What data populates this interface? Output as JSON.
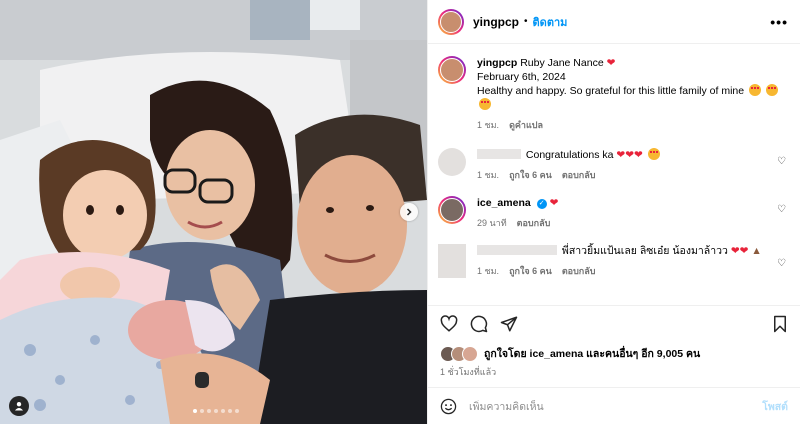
{
  "header": {
    "username": "yingpcp",
    "separator": "•",
    "follow_label": "ติดตาม",
    "more_label": "•••"
  },
  "caption": {
    "username": "yingpcp",
    "line1": "Ruby Jane Nance",
    "line2": "February 6th, 2024",
    "line3": "Healthy and happy. So grateful for this little family of mine",
    "time": "1 ชม.",
    "translate_label": "ดูคำแปล"
  },
  "comments": [
    {
      "username": "",
      "text": "Congratulations ka",
      "time": "1 ชม.",
      "likes_label": "ถูกใจ 6 คน",
      "reply_label": "ตอบกลับ"
    },
    {
      "username": "ice_amena",
      "verified": true,
      "text": "",
      "time": "29 นาที",
      "reply_label": "ตอบกลับ"
    },
    {
      "username": "",
      "text": "พี่สาวยิ้มแป้นเลย ลิซเอ๋ย น้องมาล้าวว",
      "time": "1 ชม.",
      "likes_label": "ถูกใจ 6 คน",
      "reply_label": "ตอบกลับ"
    }
  ],
  "likes": {
    "text": "ถูกใจโดย ice_amena และคนอื่นๆ อีก 9,005 คน"
  },
  "time_ago": "1 ชั่วโมงที่แล้ว",
  "add_comment": {
    "placeholder": "เพิ่มความคิดเห็น",
    "post_label": "โพสต์"
  },
  "carousel": {
    "count": 7,
    "active_index": 0
  },
  "colors": {
    "follow": "#0095f6",
    "heart": "#e8233a",
    "muted": "#737373",
    "post_disabled": "#b2dffc"
  },
  "icons": [
    "heart-icon",
    "comment-icon",
    "share-icon",
    "bookmark-icon",
    "emoji-icon",
    "chevron-right-icon",
    "user-tag-icon"
  ]
}
